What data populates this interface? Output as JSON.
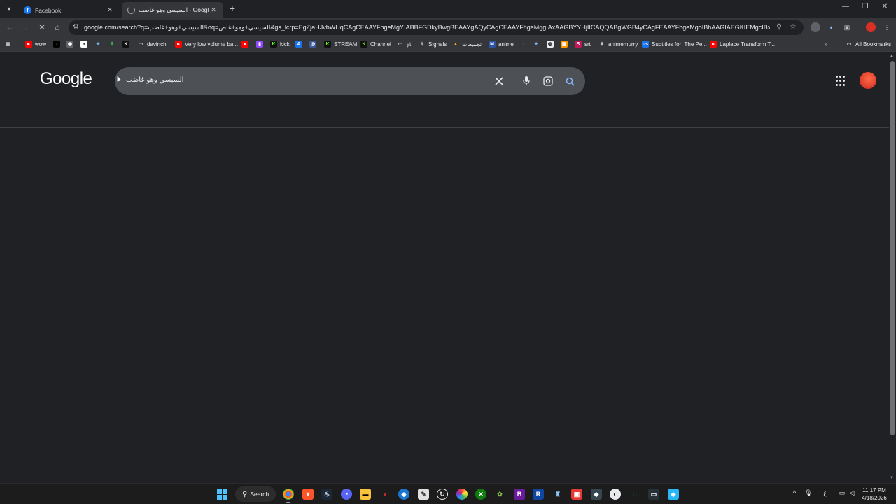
{
  "browser": {
    "tabs": [
      {
        "title": "Facebook",
        "icon": "facebook-icon"
      },
      {
        "title": "السيسي وهو غاضب - Google Search",
        "icon": "google-icon"
      }
    ],
    "url": "google.com/search?q=السيسي+وهو+غاضب&oq=السيسي+وهو+غاض&gs_lcrp=EgZjaHJvbWUqCAgCEAAYFhgeMgYIABBFGDkyBwgBEAAYgAQyCAgCEAAYFhgeMggIAxAAGBYYHjIICAQQABgWGB4yCAgFEAAYFhgeMgoIBhAAGIAEGKIEMgcIBxAAGO8FMgcICBAA..."
  },
  "bookmarks": [
    {
      "label": "wow",
      "icon": "youtube-icon"
    },
    {
      "label": "",
      "icon": "tiktok-icon"
    },
    {
      "label": "",
      "icon": "bookmark-icon"
    },
    {
      "label": "",
      "icon": "amazon-icon"
    },
    {
      "label": "",
      "icon": "star-icon"
    },
    {
      "label": "",
      "icon": "download-icon"
    },
    {
      "label": "",
      "icon": "k-icon"
    },
    {
      "label": "davinchi",
      "icon": "folder-icon"
    },
    {
      "label": "Very low volume ba...",
      "icon": "youtube-icon"
    },
    {
      "label": "",
      "icon": "youtube-icon"
    },
    {
      "label": "",
      "icon": "twitch-icon"
    },
    {
      "label": "kick",
      "icon": "kick-icon"
    },
    {
      "label": "",
      "icon": "app-icon"
    },
    {
      "label": "",
      "icon": "app-icon"
    },
    {
      "label": "STREAM",
      "icon": "kick-icon"
    },
    {
      "label": "Channel",
      "icon": "kick-icon"
    },
    {
      "label": "yt",
      "icon": "folder-icon"
    },
    {
      "label": "Signals",
      "icon": "signals-icon"
    },
    {
      "label": "تجميعات",
      "icon": "drive-icon"
    },
    {
      "label": "anime",
      "icon": "anime-icon"
    },
    {
      "label": "",
      "icon": "app-icon"
    },
    {
      "label": "",
      "icon": "star-icon"
    },
    {
      "label": "",
      "icon": "app-icon"
    },
    {
      "label": "",
      "icon": "app-icon"
    },
    {
      "label": "srt",
      "icon": "srt-icon"
    },
    {
      "label": "animemurry",
      "icon": "person-icon"
    },
    {
      "label": "Subtitles for: The Pe...",
      "icon": "subtitle-icon"
    },
    {
      "label": "Laplace Transform T...",
      "icon": "youtube-icon"
    }
  ],
  "bookmarks_all": "All Bookmarks",
  "google": {
    "logo": "Google",
    "query": "السيسي وهو غاضب"
  },
  "taskbar": {
    "search_label": "Search",
    "time": "11:17 PM",
    "date": "4/18/2026",
    "lang": "ع"
  }
}
